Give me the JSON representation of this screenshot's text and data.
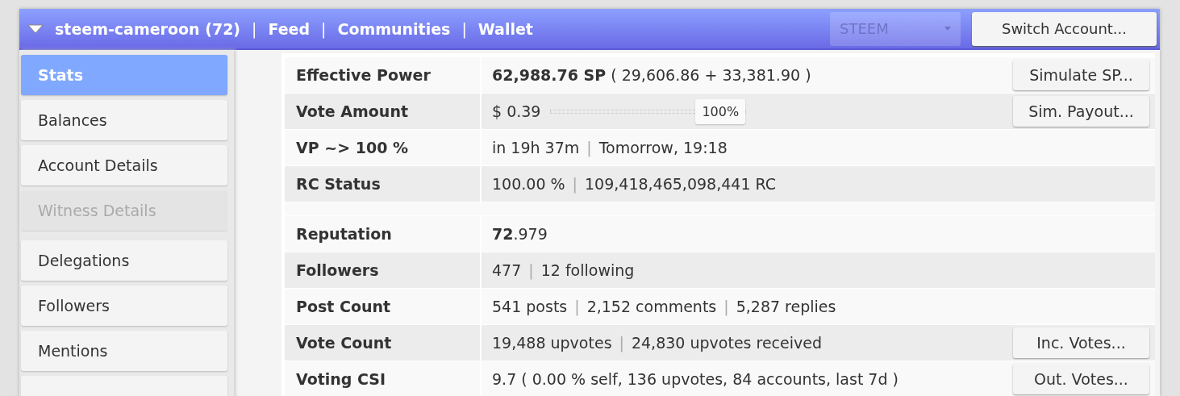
{
  "header": {
    "account": "steem-cameroon (72)",
    "links": [
      {
        "sep": "|",
        "text": "Feed"
      },
      {
        "sep": "|",
        "text": "Communities"
      },
      {
        "sep": "|",
        "text": "Wallet"
      }
    ],
    "currency": {
      "value": "STEEM",
      "disabled": true
    },
    "button": "Switch Account..."
  },
  "sidebar": {
    "groups": [
      [
        {
          "label": "Stats",
          "selected": true,
          "disabled": false
        },
        {
          "label": "Balances",
          "selected": false,
          "disabled": false
        },
        {
          "label": "Account Details",
          "selected": false,
          "disabled": false
        },
        {
          "label": "Witness Details",
          "selected": false,
          "disabled": true
        }
      ],
      [
        {
          "label": "Delegations",
          "selected": false,
          "disabled": false
        },
        {
          "label": "Followers",
          "selected": false,
          "disabled": false
        },
        {
          "label": "Mentions",
          "selected": false,
          "disabled": false
        },
        {
          "selected": false,
          "disabled": false
        }
      ]
    ]
  },
  "stats": {
    "groups": [
      [
        {
          "label": "Effective Power",
          "parts": [
            {
              "text": "**62,988.76 SP** ( 29,606.86 + 33,381.90 )"
            }
          ],
          "button": "Simulate SP..."
        },
        {
          "label": "Vote Amount",
          "parts": [
            {
              "text": "$ 0.39"
            }
          ],
          "slider": {
            "level": 1,
            "reading": "100%"
          },
          "button": "Sim. Payout..."
        },
        {
          "label": "VP ~> 100 %",
          "parts": [
            {
              "text": "in 19h 37m"
            },
            {
              "sep": "|",
              "text": "Tomorrow, 19:18"
            }
          ]
        },
        {
          "label": "RC Status",
          "parts": [
            {
              "text": "100.00 %"
            },
            {
              "sep": "|",
              "text": "109,418,465,098,441 RC"
            }
          ]
        }
      ],
      [
        {
          "label": "Reputation",
          "parts": [
            {
              "text": "**72**.979"
            }
          ]
        },
        {
          "label": "Followers",
          "parts": [
            {
              "text": "477"
            },
            {
              "sep": "|",
              "text": "12 following"
            }
          ]
        },
        {
          "label": "Post Count",
          "parts": [
            {
              "text": "541 posts"
            },
            {
              "sep": "|",
              "text": "2,152 comments"
            },
            {
              "sep": "|",
              "text": "5,287 replies"
            }
          ]
        },
        {
          "label": "Vote Count",
          "parts": [
            {
              "text": "19,488 upvotes"
            },
            {
              "sep": "|",
              "text": "24,830 upvotes received"
            }
          ],
          "button": "Inc. Votes..."
        },
        {
          "label": "Voting CSI",
          "parts": [
            {
              "text": "9.7 ( 0.00 % self, 136 upvotes, 84 accounts, last 7d )"
            }
          ],
          "button": "Out. Votes..."
        }
      ]
    ]
  }
}
